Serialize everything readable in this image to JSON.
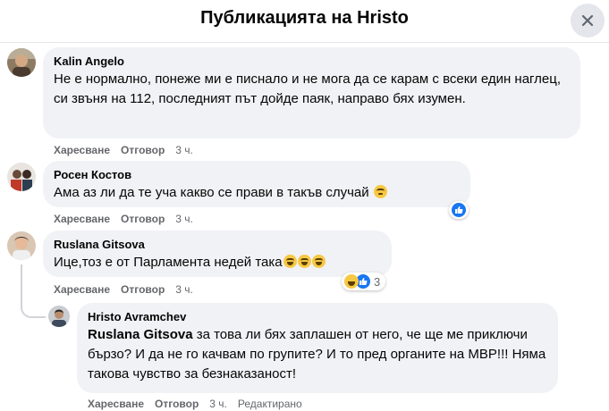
{
  "header": {
    "title": "Публикацията на Hristo",
    "close_icon": "close-icon"
  },
  "actions": {
    "like": "Харесване",
    "reply": "Отговор",
    "edited": "Редактирано"
  },
  "comments": [
    {
      "author": "Kalin Angelo",
      "text": "Не е нормално, понеже ми е писнало и не мога да се карам с всеки един наглец, си звъня на 112, последният път дойде паяк, направо бях изумен.",
      "time": "3 ч."
    },
    {
      "author": "Росен Костов",
      "text": "Ама аз ли да те уча какво се прави в такъв случай",
      "emoji": "thinking-face",
      "reactions": {
        "types": [
          "like"
        ],
        "count": ""
      },
      "time": "3 ч."
    },
    {
      "author": "Ruslana Gitsova",
      "text": "Ице,тоз е от Парламента недей така",
      "emoji": "laughing-face",
      "reactions": {
        "types": [
          "haha",
          "like"
        ],
        "count": "3"
      },
      "time": "3 ч."
    },
    {
      "author": "Hristo Avramchev",
      "mention": "Ruslana Gitsova",
      "text": " за това ли бях заплашен от него, че ще ме приключи бързо? И да не го качвам по групите? И то пред органите на МВР!!! Няма такова чувство за безнаказаност!",
      "time": "3 ч.",
      "edited": true
    }
  ],
  "colors": {
    "bubble": "#f0f2f5",
    "meta": "#65676b",
    "like_blue": "#1877f2",
    "divider": "#e4e6eb"
  }
}
